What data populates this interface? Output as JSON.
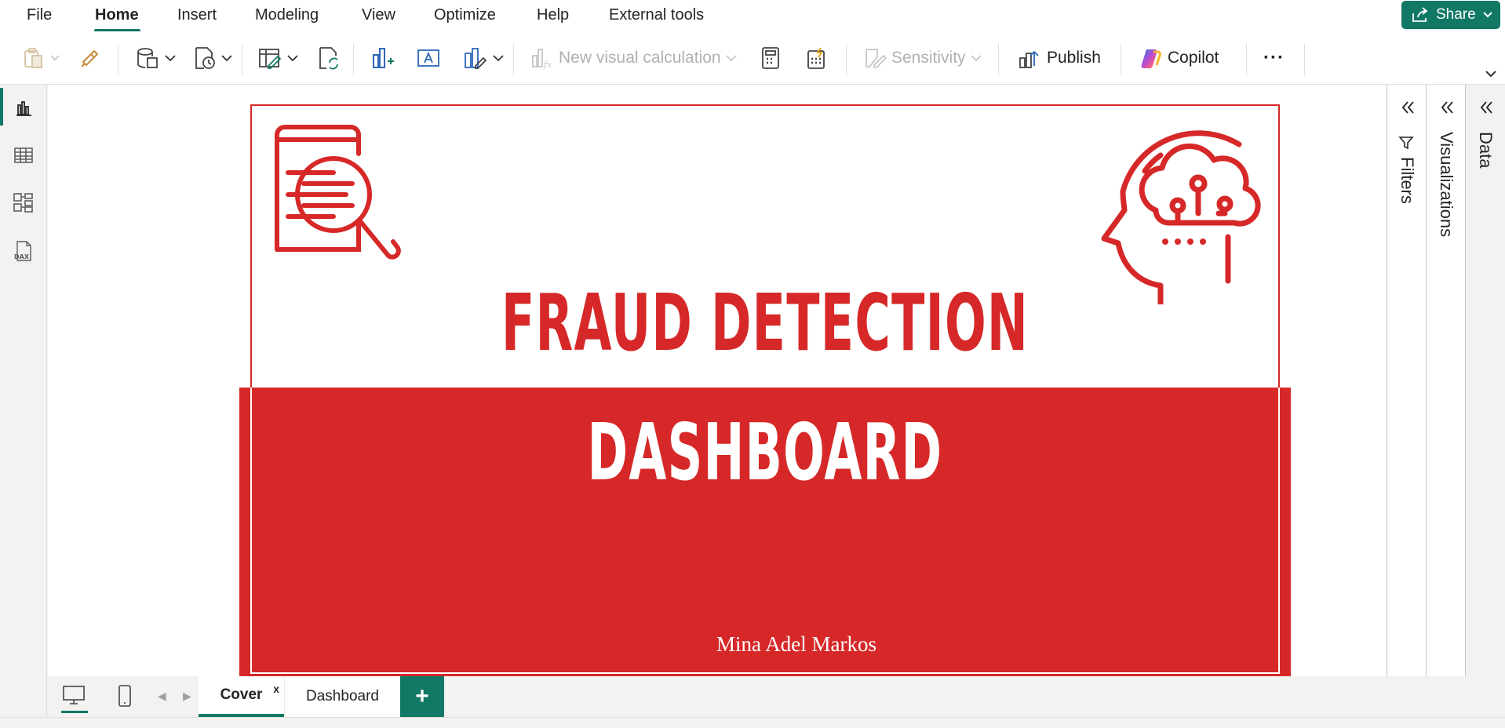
{
  "menubar": {
    "items": [
      "File",
      "Home",
      "Insert",
      "Modeling",
      "View",
      "Optimize",
      "Help",
      "External tools"
    ],
    "share_label": "Share"
  },
  "ribbon": {
    "new_visual_calculation": "New visual calculation",
    "sensitivity": "Sensitivity",
    "publish": "Publish",
    "copilot": "Copilot",
    "more": "···"
  },
  "report": {
    "title_line_1": "FRAUD DETECTION",
    "title_line_2": "DASHBOARD",
    "author": "Mina Adel Markos",
    "colors": {
      "brand_red": "#d62828",
      "white": "#ffffff"
    }
  },
  "panes": {
    "filters": "Filters",
    "visualizations": "Visualizations",
    "data": "Data"
  },
  "page_tabs": {
    "cover": "Cover",
    "cover_close": "x",
    "dashboard": "Dashboard",
    "add": "+"
  },
  "theme": {
    "accent": "#117865"
  }
}
